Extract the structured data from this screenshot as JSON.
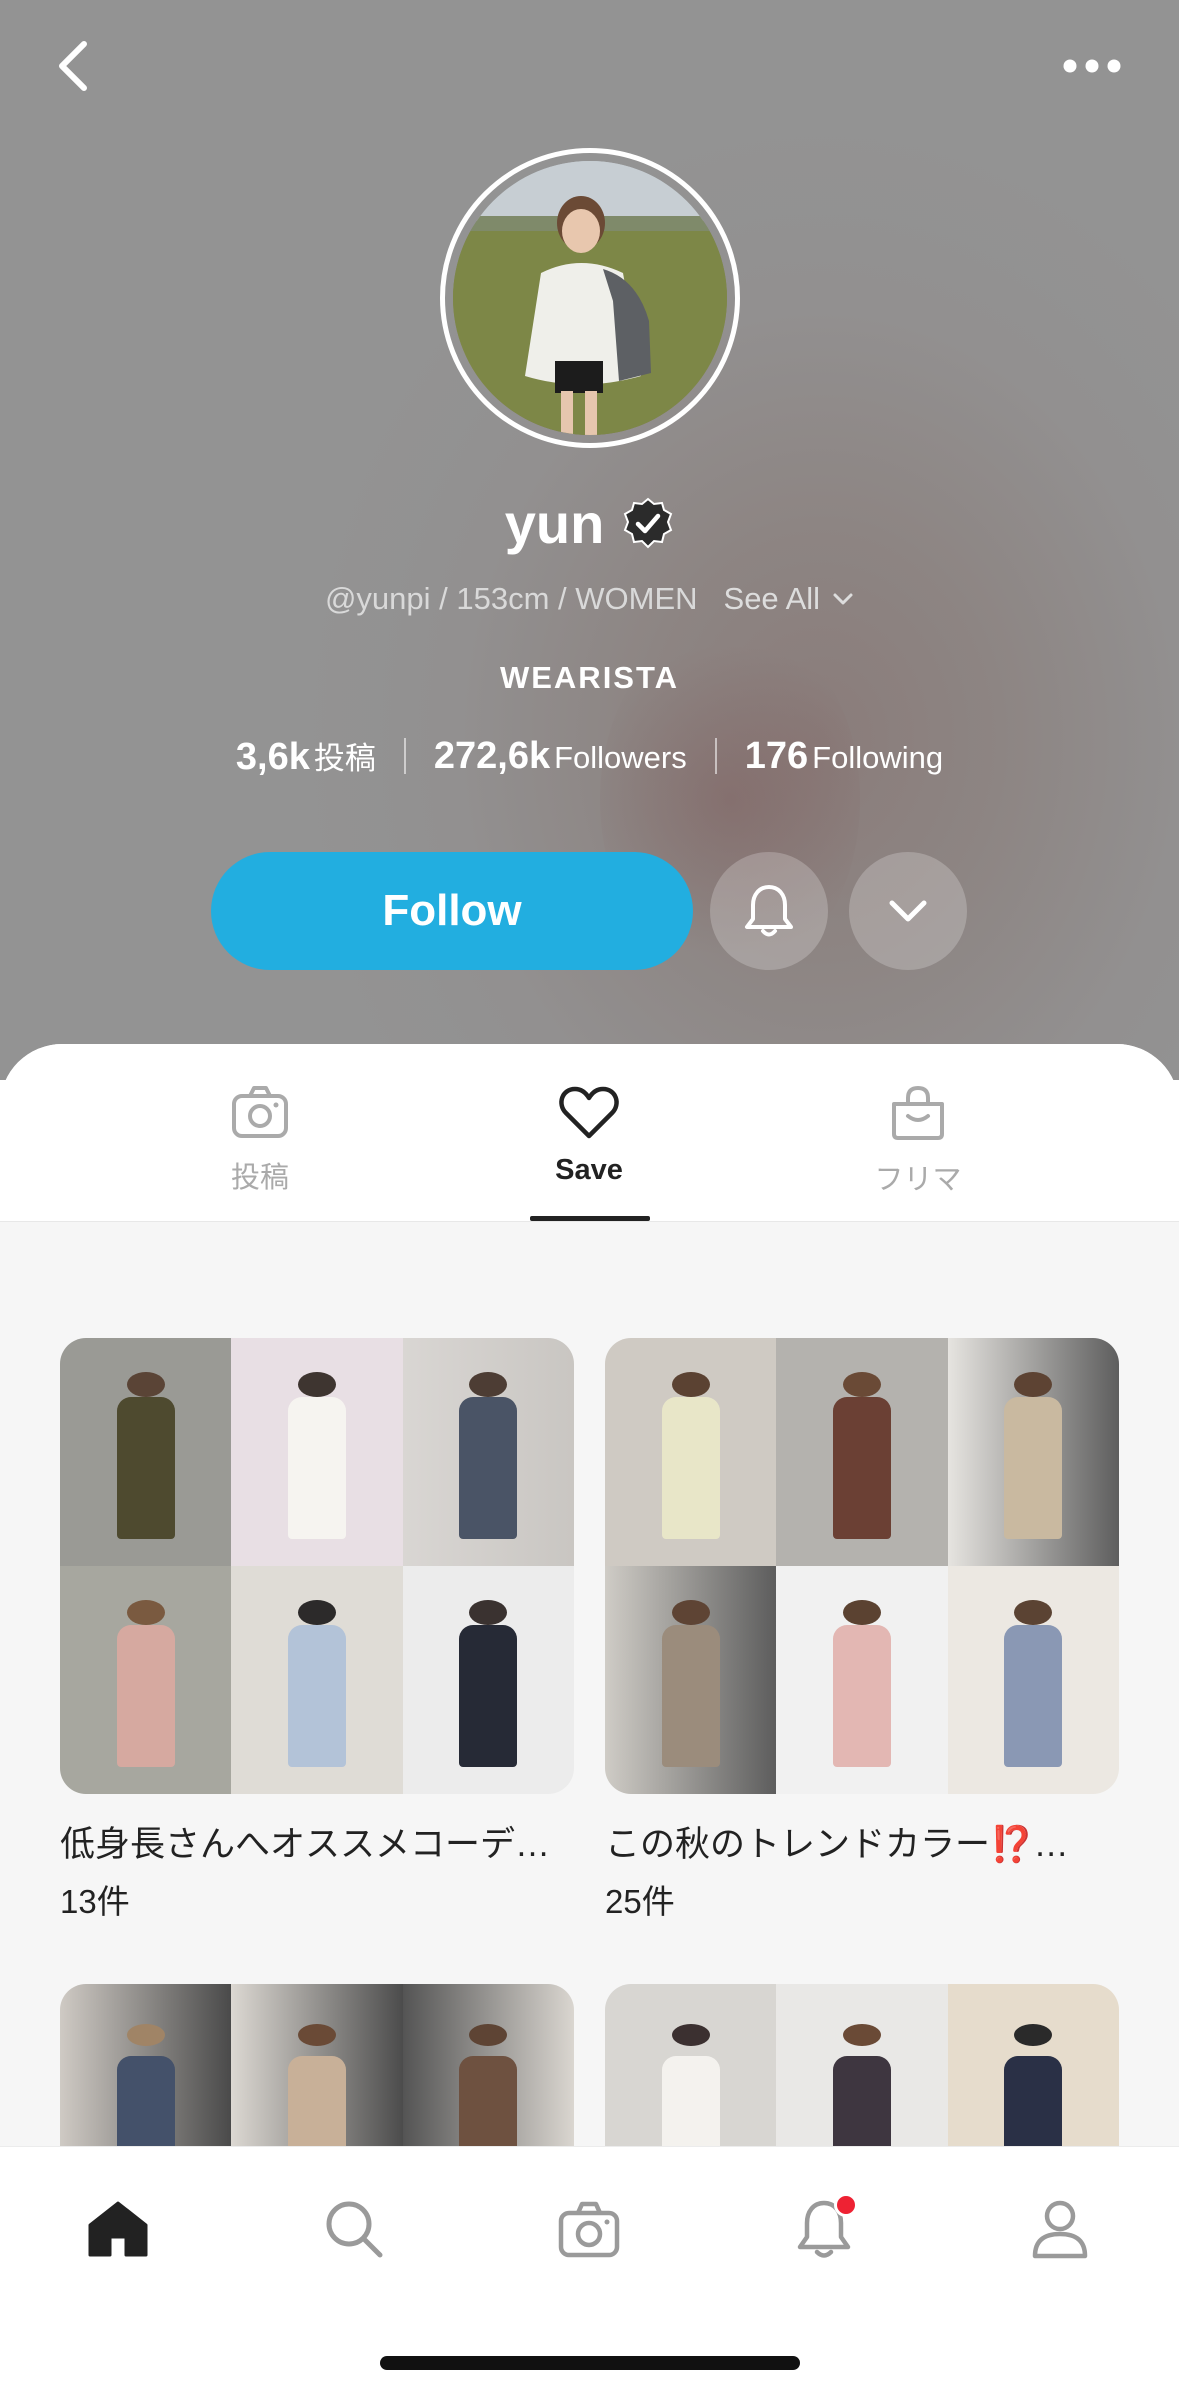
{
  "header": {
    "back_icon": "chevron-left-icon",
    "more_icon": "more-horizontal-icon"
  },
  "profile": {
    "name": "yun",
    "verified_icon": "verified-badge-icon",
    "subtitle": "@yunpi / 153cm / WOMEN",
    "see_all": "See All",
    "role": "WEARISTA",
    "stats": {
      "posts_value": "3,6k",
      "posts_label": "投稿",
      "followers_value": "272,6k",
      "followers_label": "Followers",
      "following_value": "176",
      "following_label": "Following"
    },
    "follow_label": "Follow",
    "accent_color": "#22aee0"
  },
  "tabs": [
    {
      "label": "投稿",
      "icon": "camera-icon",
      "active": false
    },
    {
      "label": "Save",
      "icon": "heart-icon",
      "active": true
    },
    {
      "label": "フリマ",
      "icon": "shopping-bag-icon",
      "active": false
    }
  ],
  "collections": [
    {
      "title": "低身長さんへオススメコーデ…",
      "count": "13件"
    },
    {
      "title": "この秋のトレンドカラー⁉️…",
      "count": "25件"
    },
    {
      "title": "",
      "count": ""
    },
    {
      "title": "",
      "count": ""
    }
  ],
  "bottom_nav": [
    {
      "icon": "home-icon",
      "active": true
    },
    {
      "icon": "search-icon",
      "active": false
    },
    {
      "icon": "camera-icon",
      "active": false
    },
    {
      "icon": "bell-icon",
      "active": false,
      "has_badge": true
    },
    {
      "icon": "profile-icon",
      "active": false
    }
  ]
}
